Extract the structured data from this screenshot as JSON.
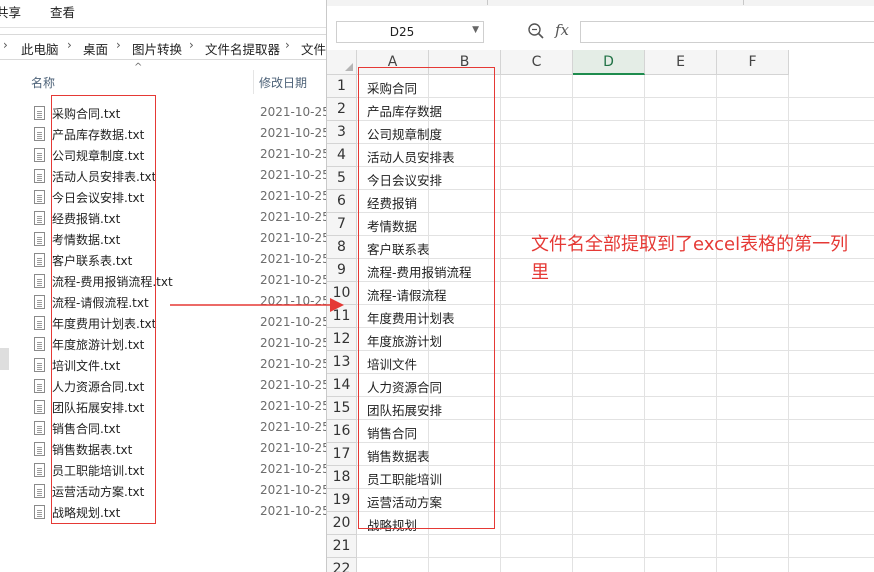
{
  "explorer": {
    "ribbon_tabs": [
      "共享",
      "查看"
    ],
    "breadcrumb": [
      "此电脑",
      "桌面",
      "图片转换",
      "文件名提取器",
      "文件"
    ],
    "columns": {
      "name": "名称",
      "date": "修改日期"
    },
    "files": [
      {
        "name": "采购合同.txt",
        "date": "2021-10-25"
      },
      {
        "name": "产品库存数据.txt",
        "date": "2021-10-25"
      },
      {
        "name": "公司规章制度.txt",
        "date": "2021-10-25"
      },
      {
        "name": "活动人员安排表.txt",
        "date": "2021-10-25"
      },
      {
        "name": "今日会议安排.txt",
        "date": "2021-10-25"
      },
      {
        "name": "经费报销.txt",
        "date": "2021-10-25"
      },
      {
        "name": "考情数据.txt",
        "date": "2021-10-25"
      },
      {
        "name": "客户联系表.txt",
        "date": "2021-10-25"
      },
      {
        "name": "流程-费用报销流程.txt",
        "date": "2021-10-25"
      },
      {
        "name": "流程-请假流程.txt",
        "date": "2021-10-25"
      },
      {
        "name": "年度费用计划表.txt",
        "date": "2021-10-25"
      },
      {
        "name": "年度旅游计划.txt",
        "date": "2021-10-25"
      },
      {
        "name": "培训文件.txt",
        "date": "2021-10-25"
      },
      {
        "name": "人力资源合同.txt",
        "date": "2021-10-25"
      },
      {
        "name": "团队拓展安排.txt",
        "date": "2021-10-25"
      },
      {
        "name": "销售合同.txt",
        "date": "2021-10-25"
      },
      {
        "name": "销售数据表.txt",
        "date": "2021-10-25"
      },
      {
        "name": "员工职能培训.txt",
        "date": "2021-10-25"
      },
      {
        "name": "运营活动方案.txt",
        "date": "2021-10-25"
      },
      {
        "name": "战略规划.txt",
        "date": "2021-10-25"
      }
    ]
  },
  "sheet": {
    "namebox": "D25",
    "fx_label": "fx",
    "formula": "",
    "columns": [
      "A",
      "B",
      "C",
      "D",
      "E",
      "F"
    ],
    "active_column": "D",
    "rows": [
      "1",
      "2",
      "3",
      "4",
      "5",
      "6",
      "7",
      "8",
      "9",
      "10",
      "11",
      "12",
      "13",
      "14",
      "15",
      "16",
      "17",
      "18",
      "19",
      "20",
      "21",
      "22"
    ],
    "column_a": [
      "采购合同",
      "产品库存数据",
      "公司规章制度",
      "活动人员安排表",
      "今日会议安排",
      "经费报销",
      "考情数据",
      "客户联系表",
      "流程-费用报销流程",
      "流程-请假流程",
      "年度费用计划表",
      "年度旅游计划",
      "培训文件",
      "人力资源合同",
      "团队拓展安排",
      "销售合同",
      "销售数据表",
      "员工职能培训",
      "运营活动方案",
      "战略规划"
    ]
  },
  "annotation": {
    "text": "文件名全部提取到了excel表格的第一列里",
    "color": "#e53935"
  },
  "colors": {
    "highlight": "#e53935",
    "active_column": "#1e8c4e",
    "header_bg": "#f5f5f5"
  }
}
